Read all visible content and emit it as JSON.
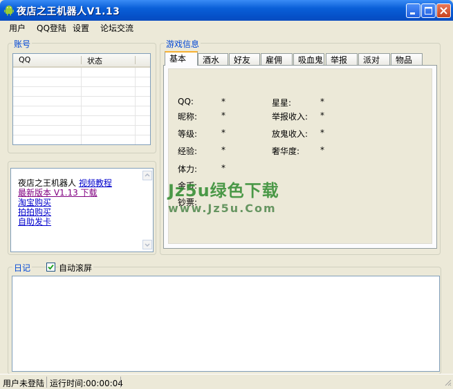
{
  "window": {
    "title": "夜店之王机器人V1.13",
    "buttons": [
      "minimize",
      "maximize",
      "close"
    ]
  },
  "menu": [
    "用户",
    "QQ登陆",
    "设置",
    "论坛交流"
  ],
  "account_group": {
    "title": "账号",
    "columns": [
      "QQ",
      "状态"
    ],
    "rows": []
  },
  "links": {
    "line1_text": "夜店之王机器人",
    "video_tutorial": "视频教程",
    "latest_version": "最新版本 V1.13 下载",
    "taobao": "淘宝购买",
    "paipai": "拍拍购买",
    "auto_card": "自助发卡"
  },
  "game_info": {
    "title": "游戏信息",
    "tabs": [
      "基本",
      "酒水",
      "好友",
      "雇佣",
      "吸血鬼",
      "举报",
      "派对",
      "物品"
    ],
    "active_tab": "基本",
    "fields_left": [
      {
        "label": "QQ:",
        "value": "*"
      },
      {
        "label": "昵称:",
        "value": "*"
      },
      {
        "label": "等级:",
        "value": "*"
      },
      {
        "label": "经验:",
        "value": "*"
      },
      {
        "label": "体力:",
        "value": "*"
      },
      {
        "label": "金币:",
        "value": ""
      },
      {
        "label": "钞票:",
        "value": ""
      }
    ],
    "fields_right": [
      {
        "label": "星星:",
        "value": "*"
      },
      {
        "label": "举报收入:",
        "value": "*"
      },
      {
        "label": "放鬼收入:",
        "value": "*"
      },
      {
        "label": "奢华度:",
        "value": "*"
      }
    ]
  },
  "watermark": {
    "line1": "Jz5u绿色下载",
    "line2": "www.Jz5u.Com"
  },
  "log": {
    "title": "日记",
    "auto_scroll_label": "自动滚屏",
    "auto_scroll_checked": true
  },
  "status": {
    "login": "用户未登陆",
    "runtime": "运行时间:00:00:04"
  },
  "colors": {
    "title_bar": "#0a5fd8",
    "group_title": "#0046d5",
    "link": "#0000cc",
    "watermark": "#2e8b2e"
  }
}
